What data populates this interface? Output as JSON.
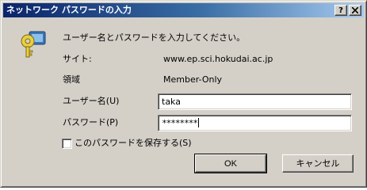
{
  "window": {
    "title": "ネットワーク パスワードの入力",
    "help_label": "?"
  },
  "dialog": {
    "prompt": "ユーザー名とパスワードを入力してください。",
    "site_label": "サイト:",
    "site_value": "www.ep.sci.hokudai.ac.jp",
    "realm_label": "領域",
    "realm_value": "Member-Only",
    "username_label": "ユーザー名(U)",
    "username_value": "taka",
    "password_label": "パスワード(P)",
    "password_value": "********",
    "save_password_label": "このパスワードを保存する(S)",
    "save_password_checked": false,
    "ok_label": "OK",
    "cancel_label": "キャンセル"
  },
  "icons": {
    "dialog_icon": "key-icon",
    "close": "close-icon"
  },
  "colors": {
    "titlebar_start": "#0a246a",
    "titlebar_end": "#a6caf0",
    "dialog_face": "#d4d0c8"
  }
}
